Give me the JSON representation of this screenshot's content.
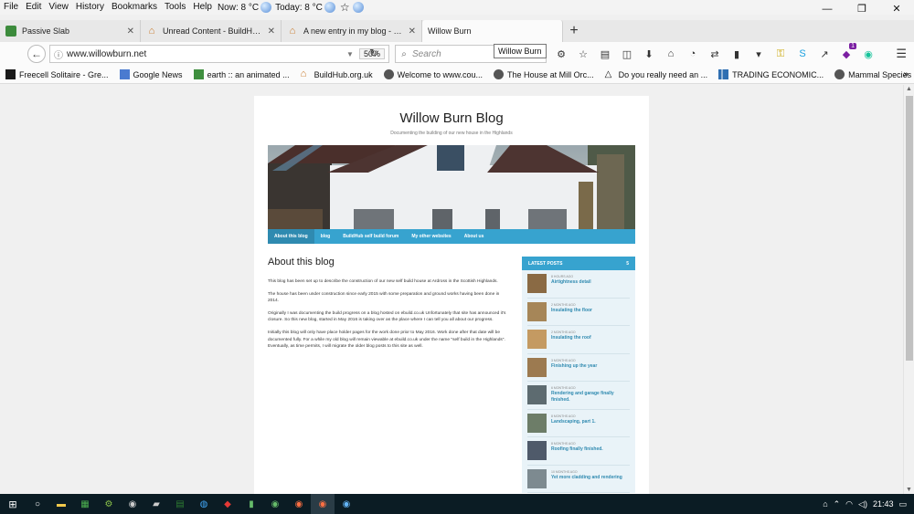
{
  "menubar": {
    "items": [
      "File",
      "Edit",
      "View",
      "History",
      "Bookmarks",
      "Tools",
      "Help"
    ],
    "weather_now": "Now: 8 °C",
    "weather_today": "Today: 8 °C"
  },
  "tabs": [
    {
      "label": "Passive Slab",
      "active": false
    },
    {
      "label": "Unread Content - BuildHub.org.uk",
      "active": false
    },
    {
      "label": "A new entry in my blog - General",
      "active": false
    },
    {
      "label": "Willow Burn",
      "active": true
    }
  ],
  "navbar": {
    "url": "www.willowburn.net",
    "zoom": "50%",
    "search_placeholder": "Search",
    "tooltip": "Willow Burn",
    "badge_count": "1"
  },
  "bookmarks": [
    {
      "label": "Freecell Solitaire - Gre...",
      "icon": "card-icon",
      "color": "#1a1a1a"
    },
    {
      "label": "Google News",
      "icon": "news-icon",
      "color": "#4a7bd0"
    },
    {
      "label": "earth :: an animated ...",
      "icon": "earth-icon",
      "color": "#3f8f3f"
    },
    {
      "label": "BuildHub.org.uk",
      "icon": "house-icon",
      "color": "#c97a2a"
    },
    {
      "label": "Welcome to www.cou...",
      "icon": "globe-icon",
      "color": "#555555"
    },
    {
      "label": "The House at Mill Orc...",
      "icon": "globe-icon",
      "color": "#555555"
    },
    {
      "label": "Do you really need an ...",
      "icon": "triangle-icon",
      "color": "#555555"
    },
    {
      "label": "TRADING ECONOMIC...",
      "icon": "chart-icon",
      "color": "#2f6fb2"
    },
    {
      "label": "Mammal Species of th...",
      "icon": "globe-icon",
      "color": "#555555"
    }
  ],
  "blog": {
    "title": "Willow Burn Blog",
    "subtitle": "Documenting the building of our new house in the Highlands",
    "nav": [
      {
        "label": "About this blog",
        "active": true
      },
      {
        "label": "blog",
        "active": false
      },
      {
        "label": "BuildHub self build forum",
        "active": false
      },
      {
        "label": "My other websites",
        "active": false
      },
      {
        "label": "About us",
        "active": false
      }
    ],
    "post_title": "About this blog",
    "paragraphs": [
      "This blog has been set up to describe the construction of our new self build house at Ardross in the Scottish Highlands.",
      "The house has been under construction since early 2015 with some preparation and ground works having been done in 2014.",
      "Originally I was documenting the build progress on a blog hosted on ebuild.co.uk Unfortunately that site has announced it's closure. So this new blog, started in May 2016 is taking over as the place where I can tell you all about our progress.",
      "Initially this blog will only have place holder pages for the work done prior to May 2016. Work done after that date will be documented fully.  For a while my old blog will remain viewable at ebuild.co.uk under the name \"self build in the Highlands\".  Eventually, as time permits, I will migrate the older blog posts to this site as well."
    ],
    "sidebar": {
      "heading": "LATEST POSTS",
      "count": "5",
      "posts": [
        {
          "meta": "8 HOURS AGO",
          "title": "Airtightness detail",
          "thumb": "#8a6a44"
        },
        {
          "meta": "2 MONTHS AGO",
          "title": "Insulating the floor",
          "thumb": "#a68658"
        },
        {
          "meta": "2 MONTHS AGO",
          "title": "Insulating the roof",
          "thumb": "#c49a62"
        },
        {
          "meta": "3 MONTHS AGO",
          "title": "Finishing up the year",
          "thumb": "#9c7a50"
        },
        {
          "meta": "6 MONTHS AGO",
          "title": "Rendering and garage finally finished.",
          "thumb": "#5d6b70"
        },
        {
          "meta": "8 MONTHS AGO",
          "title": "Landscaping, part 1.",
          "thumb": "#6d7d68"
        },
        {
          "meta": "8 MONTHS AGO",
          "title": "Roofing finally finished.",
          "thumb": "#4f5a6a"
        },
        {
          "meta": "10 MONTHS AGO",
          "title": "Yet more cladding and rendering",
          "thumb": "#7d8a90"
        }
      ]
    }
  },
  "taskbar": {
    "time": "21:43"
  }
}
